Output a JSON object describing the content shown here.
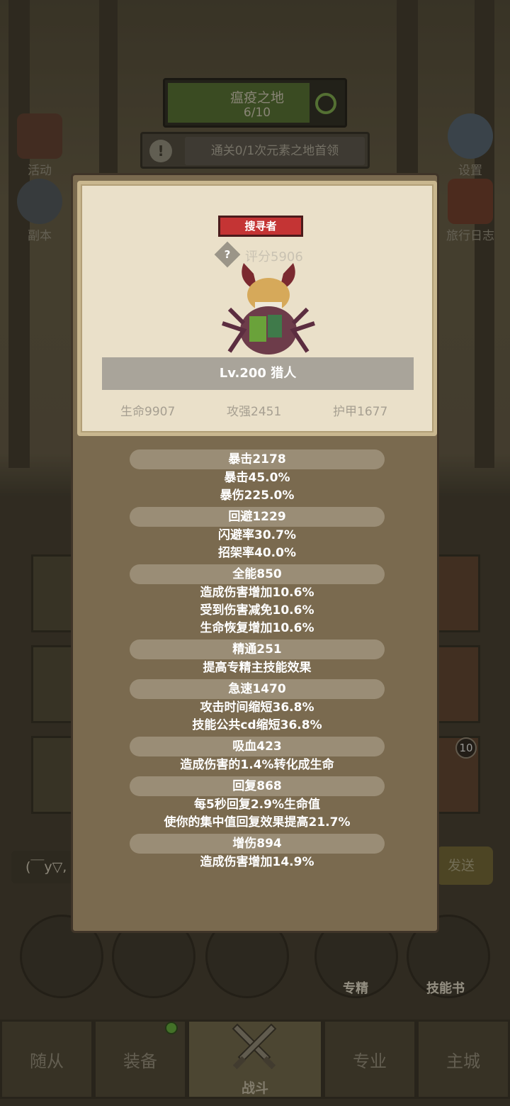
{
  "stage": {
    "name": "瘟疫之地",
    "progress": "6/10"
  },
  "quest": {
    "text": "通关0/1次元素之地首领"
  },
  "side_left": [
    {
      "label": "活动"
    },
    {
      "label": "副本"
    }
  ],
  "side_right": [
    {
      "label": "设置"
    },
    {
      "label": "旅行日志"
    }
  ],
  "slot_badge": "10",
  "chat": {
    "input_text": "(￣y▽,",
    "send_label": "发送"
  },
  "actions": [
    {
      "label": "专精"
    },
    {
      "label": "技能书"
    }
  ],
  "tabs": [
    {
      "label": "随从"
    },
    {
      "label": "装备"
    },
    {
      "label": "战斗"
    },
    {
      "label": "专业"
    },
    {
      "label": "主城"
    }
  ],
  "modal": {
    "role": "搜寻者",
    "score": "评分5906",
    "name": "Lv.200 猎人",
    "base_stats": [
      "生命9907",
      "攻强2451",
      "护甲1677"
    ],
    "groups": [
      {
        "title": "暴击2178",
        "lines": [
          "暴击45.0%",
          "暴伤225.0%"
        ]
      },
      {
        "title": "回避1229",
        "lines": [
          "闪避率30.7%",
          "招架率40.0%"
        ]
      },
      {
        "title": "全能850",
        "lines": [
          "造成伤害增加10.6%",
          "受到伤害减免10.6%",
          "生命恢复增加10.6%"
        ]
      },
      {
        "title": "精通251",
        "lines": [
          "提高专精主技能效果"
        ]
      },
      {
        "title": "急速1470",
        "lines": [
          "攻击时间缩短36.8%",
          "技能公共cd缩短36.8%"
        ]
      },
      {
        "title": "吸血423",
        "lines": [
          "造成伤害的1.4%转化成生命"
        ]
      },
      {
        "title": "回复868",
        "lines": [
          "每5秒回复2.9%生命值",
          "使你的集中值回复效果提高21.7%"
        ]
      },
      {
        "title": "增伤894",
        "lines": [
          "造成伤害增加14.9%"
        ]
      }
    ]
  }
}
